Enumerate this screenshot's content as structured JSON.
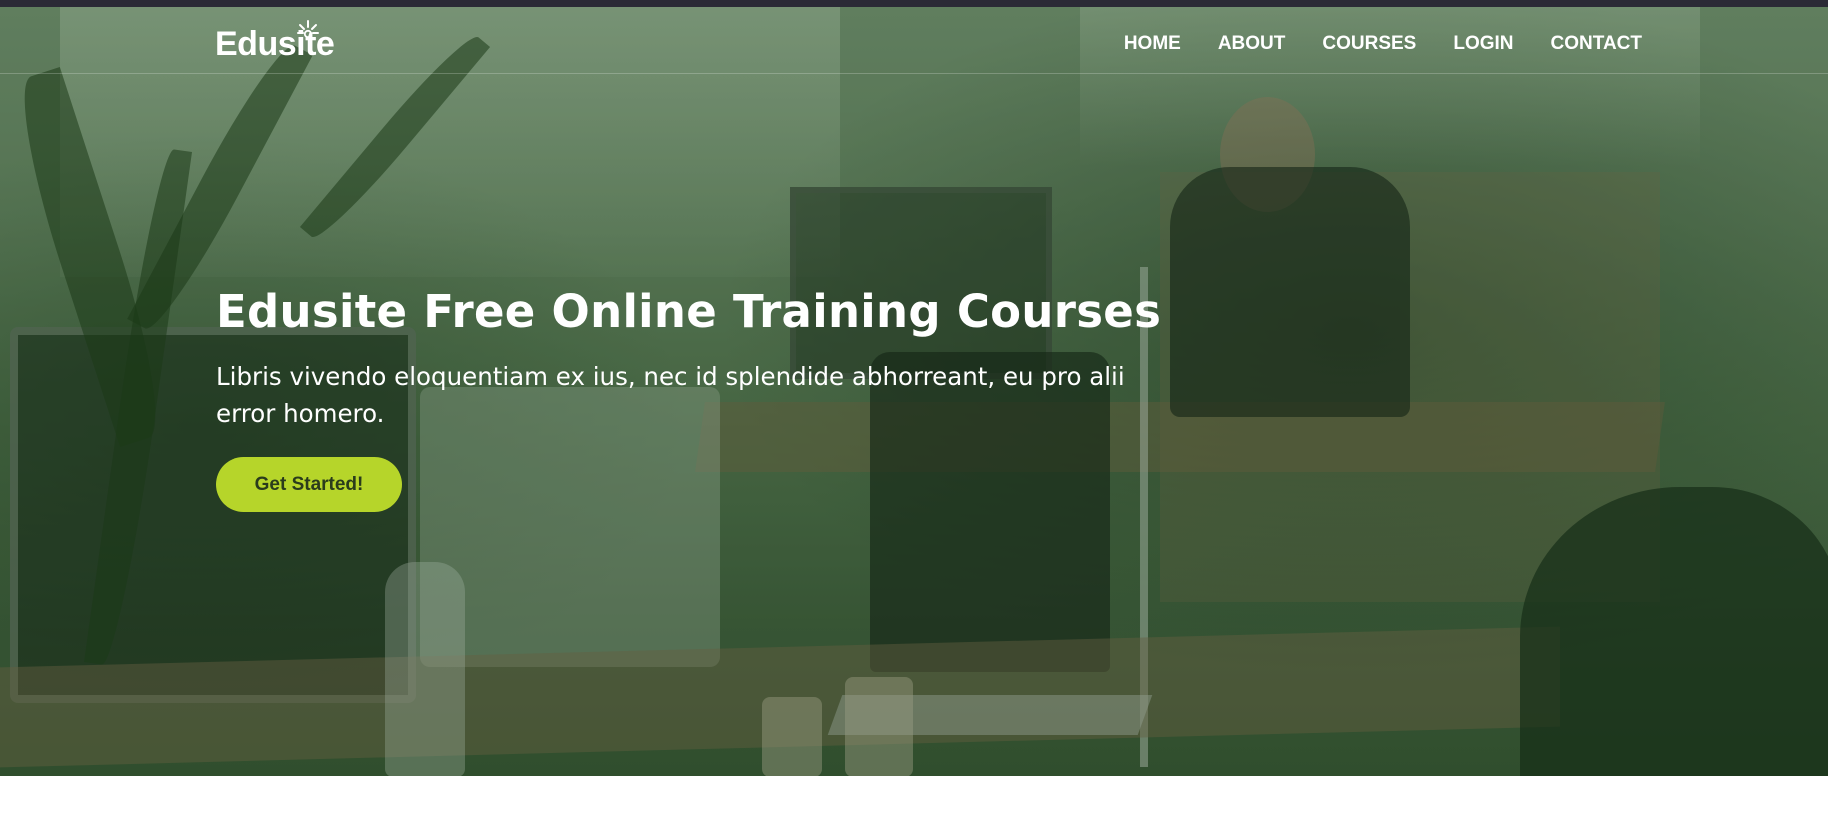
{
  "brand": {
    "name": "Edusite",
    "accent": "#b6d52a",
    "overlay": "#4c6b48"
  },
  "nav": {
    "items": [
      {
        "label": "HOME"
      },
      {
        "label": "ABOUT"
      },
      {
        "label": "COURSES"
      },
      {
        "label": "LOGIN"
      },
      {
        "label": "CONTACT"
      }
    ]
  },
  "hero": {
    "title": "Edusite Free Online Training Courses",
    "subtitle": "Libris vivendo eloquentiam ex ius, nec id splendide abhorreant, eu pro alii error homero.",
    "cta_label": "Get Started!",
    "background_image": "office-workspace-photo"
  },
  "icons": {
    "logo_mark": "sparkle-icon"
  }
}
